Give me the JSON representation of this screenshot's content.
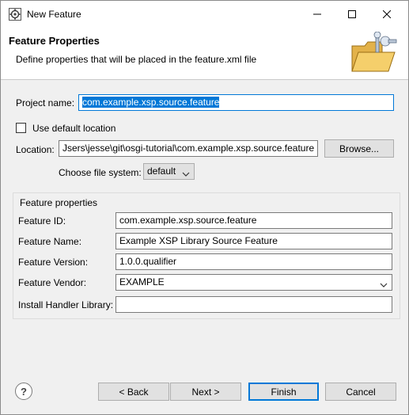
{
  "window": {
    "title": "New Feature"
  },
  "header": {
    "title": "Feature Properties",
    "description": "Define properties that will be placed in the feature.xml file"
  },
  "project": {
    "label": "Project name:",
    "value": "com.example.xsp.source.feature"
  },
  "default_location": {
    "label": "Use default location",
    "checked": false
  },
  "location": {
    "label": "Location:",
    "value": "Jsers\\jesse\\git\\osgi-tutorial\\com.example.xsp.source.feature",
    "browse_label": "Browse..."
  },
  "file_system": {
    "label": "Choose file system:",
    "selected": "default"
  },
  "feature_properties": {
    "group_title": "Feature properties",
    "id": {
      "label": "Feature ID:",
      "value": "com.example.xsp.source.feature"
    },
    "name": {
      "label": "Feature Name:",
      "value": "Example XSP Library Source Feature"
    },
    "version": {
      "label": "Feature Version:",
      "value": "1.0.0.qualifier"
    },
    "vendor": {
      "label": "Feature Vendor:",
      "value": "EXAMPLE"
    },
    "install_handler": {
      "label": "Install Handler Library:",
      "value": ""
    }
  },
  "buttons": {
    "back": "< Back",
    "next": "Next >",
    "finish": "Finish",
    "cancel": "Cancel",
    "help": "?"
  },
  "colors": {
    "accent": "#0078d7",
    "background": "#f0f0f0"
  }
}
